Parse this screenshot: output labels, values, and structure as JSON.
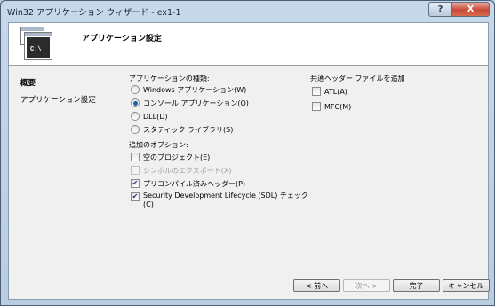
{
  "window": {
    "title": "Win32 アプリケーション ウィザード - ex1-1",
    "help_label": "?",
    "close_label": "X"
  },
  "header": {
    "icon_text": "C:\\_",
    "title": "アプリケーション設定"
  },
  "sidebar": {
    "items": [
      {
        "label": "概要"
      },
      {
        "label": "アプリケーション設定"
      }
    ]
  },
  "app_type": {
    "label": "アプリケーションの種類:",
    "options": [
      {
        "label": "Windows アプリケーション(W)",
        "selected": false
      },
      {
        "label": "コンソール アプリケーション(O)",
        "selected": true
      },
      {
        "label": "DLL(D)",
        "selected": false
      },
      {
        "label": "スタティック ライブラリ(S)",
        "selected": false
      }
    ]
  },
  "additional_options": {
    "label": "追加のオプション:",
    "options": [
      {
        "label": "空のプロジェクト(E)",
        "checked": false,
        "enabled": true
      },
      {
        "label": "シンボルのエクスポート(X)",
        "checked": false,
        "enabled": false
      },
      {
        "label": "プリコンパイル済みヘッダー(P)",
        "checked": true,
        "enabled": true
      },
      {
        "label": "Security Development Lifecycle (SDL) チェック(C)",
        "checked": true,
        "enabled": true
      }
    ]
  },
  "common_headers": {
    "label": "共通ヘッダー ファイルを追加",
    "options": [
      {
        "label": "ATL(A)",
        "checked": false
      },
      {
        "label": "MFC(M)",
        "checked": false
      }
    ]
  },
  "buttons": {
    "prev": "< 前へ",
    "next": "次へ >",
    "finish": "完了",
    "cancel": "キャンセル"
  }
}
